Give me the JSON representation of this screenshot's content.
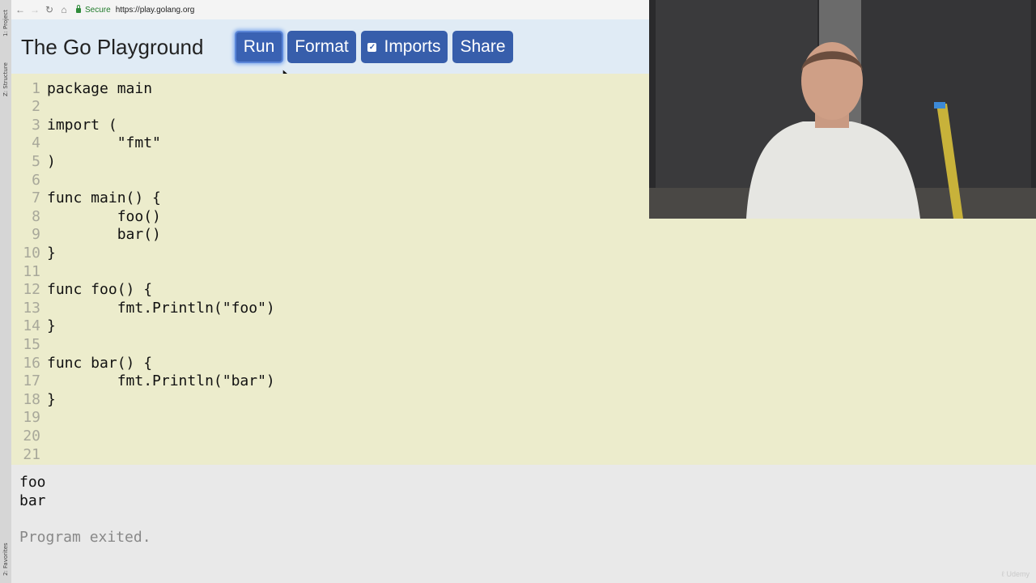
{
  "ide_strip": {
    "tabs": [
      "1: Project",
      "Z: Structure",
      "2: Favorites"
    ]
  },
  "browser": {
    "back_icon": "arrow-left-icon",
    "forward_icon": "arrow-right-icon",
    "reload_icon": "reload-icon",
    "home_icon": "home-icon",
    "secure_label": "Secure",
    "url": "https://play.golang.org"
  },
  "header": {
    "title": "The Go Playground",
    "buttons": {
      "run": "Run",
      "format": "Format",
      "imports": "Imports",
      "share": "Share"
    },
    "imports_checked": true
  },
  "editor": {
    "lines": [
      {
        "num": "1",
        "code": "package main"
      },
      {
        "num": "2",
        "code": ""
      },
      {
        "num": "3",
        "code": "import ("
      },
      {
        "num": "4",
        "code": "\t\"fmt\""
      },
      {
        "num": "5",
        "code": ")"
      },
      {
        "num": "6",
        "code": ""
      },
      {
        "num": "7",
        "code": "func main() {"
      },
      {
        "num": "8",
        "code": "\tfoo()"
      },
      {
        "num": "9",
        "code": "\tbar()"
      },
      {
        "num": "10",
        "code": "}"
      },
      {
        "num": "11",
        "code": ""
      },
      {
        "num": "12",
        "code": "func foo() {"
      },
      {
        "num": "13",
        "code": "\tfmt.Println(\"foo\")"
      },
      {
        "num": "14",
        "code": "}"
      },
      {
        "num": "15",
        "code": ""
      },
      {
        "num": "16",
        "code": "func bar() {"
      },
      {
        "num": "17",
        "code": "\tfmt.Println(\"bar\")"
      },
      {
        "num": "18",
        "code": "}"
      },
      {
        "num": "19",
        "code": ""
      },
      {
        "num": "20",
        "code": ""
      },
      {
        "num": "21",
        "code": ""
      }
    ]
  },
  "output": {
    "lines": [
      "foo",
      "bar"
    ],
    "status": "Program exited."
  },
  "watermark": {
    "text": "Udemy"
  }
}
